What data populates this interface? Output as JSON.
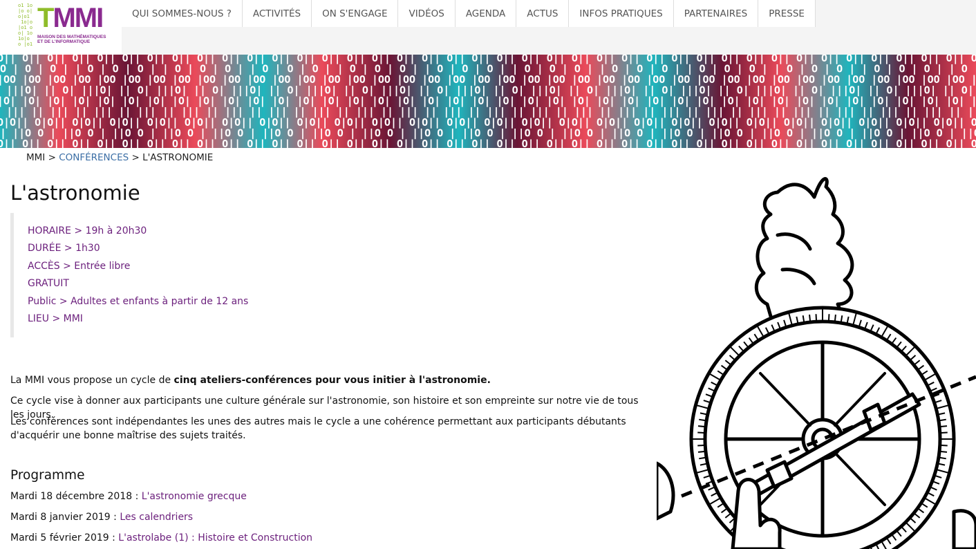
{
  "logo": {
    "mark": "MMI",
    "sub_line1": "MAISON DES MATHÉMATIQUES",
    "sub_line2": "ET DE L'INFORMATIQUE",
    "colors": {
      "purple": "#8a2a8f",
      "green": "#8fbc2a"
    }
  },
  "nav": {
    "items": [
      "QUI SOMMES-NOUS ?",
      "ACTIVITÉS",
      "ON S'ENGAGE",
      "VIDÉOS",
      "AGENDA",
      "ACTUS",
      "INFOS PRATIQUES",
      "PARTENAIRES",
      "PRESSE"
    ]
  },
  "banner": {
    "rows": [
      "O|| O|| O||",
      "| O | O | O |",
      "|OO |OO |OO",
      "O| |||O| ||",
      "|O| |O| |O|",
      "|| ||| || |||",
      "O|O|| O|O||",
      "O | ||O O | ||O"
    ],
    "colors": {
      "teal": "#1fb5bd",
      "coral": "#ea4a5a",
      "wine": "#6a1535"
    }
  },
  "breadcrumb": {
    "home": "MMI",
    "sep1": ">",
    "section": "CONFÉRENCES",
    "sep2": ">",
    "current": "L'ASTRONOMIE"
  },
  "page": {
    "title": "L'astronomie",
    "info": [
      "HORAIRE > 19h à 20h30",
      "DURÉE > 1h30",
      "ACCÈS > Entrée libre",
      "GRATUIT",
      "Public > Adultes et enfants à partir de 12 ans",
      "LIEU > MMI"
    ],
    "intro_pre": "La MMI vous propose un cycle de ",
    "intro_bold": "cinq ateliers-conférences pour vous initier à l'astronomie.",
    "para2": "Ce cycle vise à donner aux participants une culture générale sur l'astronomie, son histoire et son empreinte sur notre vie de tous les jours.",
    "para3": "Les conférences sont indépendantes les unes des autres mais le cycle a une cohérence permettant aux participants débutants d'acquérir une bonne maîtrise des sujets traités."
  },
  "programme": {
    "title": "Programme",
    "items": [
      {
        "date": "Mardi 18 décembre 2018 : ",
        "link": "L'astronomie grecque"
      },
      {
        "date": "Mardi 8 janvier 2019 : ",
        "link": "Les calendriers"
      },
      {
        "date": "Mardi 5 février 2019 : ",
        "link": "L'astrolabe (1) : Histoire et Construction"
      }
    ]
  },
  "illustration": {
    "icon": "astrolabe-hand-illustration"
  },
  "colors": {
    "accent_purple": "#6b1f7c",
    "link_blue": "#3b6ea5"
  }
}
